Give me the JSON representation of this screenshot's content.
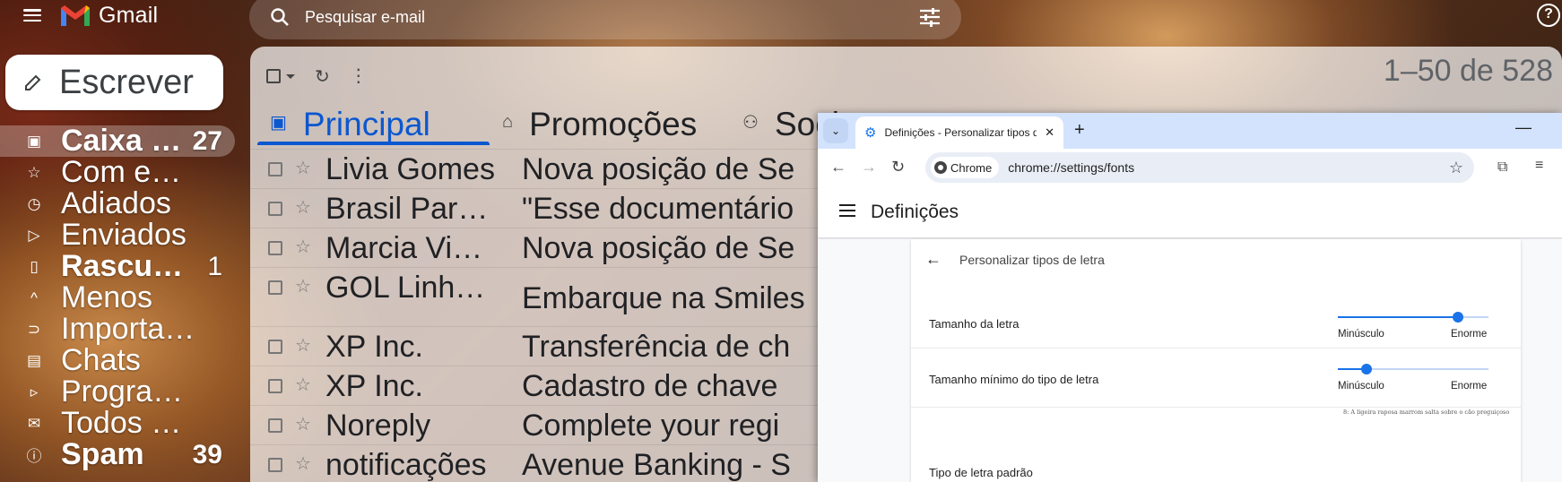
{
  "gmail": {
    "brand": "Gmail",
    "search_placeholder": "Pesquisar e-mail",
    "compose_label": "Escrever",
    "page_count": "1–50 de 528"
  },
  "sidebar": {
    "items": [
      {
        "label": "Caixa de entrada",
        "count": "27",
        "icon": "inbox-icon"
      },
      {
        "label": "Com estrela",
        "count": "",
        "icon": "star-icon"
      },
      {
        "label": "Adiados",
        "count": "",
        "icon": "clock-icon"
      },
      {
        "label": "Enviados",
        "count": "",
        "icon": "send-icon"
      },
      {
        "label": "Rascunhos",
        "count": "1",
        "icon": "draft-icon"
      },
      {
        "label": "Menos",
        "count": "",
        "icon": "chevron-up-icon"
      },
      {
        "label": "Importante",
        "count": "",
        "icon": "label-important-icon"
      },
      {
        "label": "Chats",
        "count": "",
        "icon": "chat-icon"
      },
      {
        "label": "Programados",
        "count": "",
        "icon": "scheduled-send-icon"
      },
      {
        "label": "Todos os e-mails",
        "count": "",
        "icon": "all-mail-icon"
      },
      {
        "label": "Spam",
        "count": "39",
        "icon": "spam-icon"
      }
    ]
  },
  "tabs": [
    {
      "label": "Principal",
      "icon": "inbox-icon"
    },
    {
      "label": "Promoções",
      "icon": "tag-icon"
    },
    {
      "label": "Social",
      "icon": "people-icon"
    }
  ],
  "emails": [
    {
      "sender": "Livia Gomes",
      "subject": "Nova posição de Se"
    },
    {
      "sender": "Brasil Paralelo",
      "subject": "\"Esse documentário"
    },
    {
      "sender": "Marcia Vieira",
      "subject": "Nova posição de Se"
    },
    {
      "sender": "GOL Linhas Aéreas",
      "subject": "Embarque na Smiles"
    },
    {
      "sender": "XP Inc.",
      "subject": "Transferência de ch"
    },
    {
      "sender": "XP Inc.",
      "subject": "Cadastro de chave"
    },
    {
      "sender": "Noreply",
      "subject": "Complete your regi"
    },
    {
      "sender": "notificações",
      "subject": "Avenue Banking - S"
    }
  ],
  "chrome": {
    "tab_title": "Definições - Personalizar tipos de letra",
    "chip_label": "Chrome",
    "url": "chrome://settings/fonts",
    "settings_title": "Definições",
    "subpage_title": "Personalizar tipos de letra",
    "font_size": {
      "label": "Tamanho da letra",
      "min": "Minúsculo",
      "max": "Enorme",
      "value": 0.8
    },
    "min_font_size": {
      "label": "Tamanho mínimo do tipo de letra",
      "min": "Minúsculo",
      "max": "Enorme",
      "value": 0.19
    },
    "sample_text": "8: A ligeira raposa marrom salta sobre o cão preguiçoso",
    "default_font_label": "Tipo de letra padrão"
  },
  "colors": {
    "accent": "#0b57d0",
    "chrome_blue": "#1a73e8",
    "gmail_red": "#ea4335"
  }
}
